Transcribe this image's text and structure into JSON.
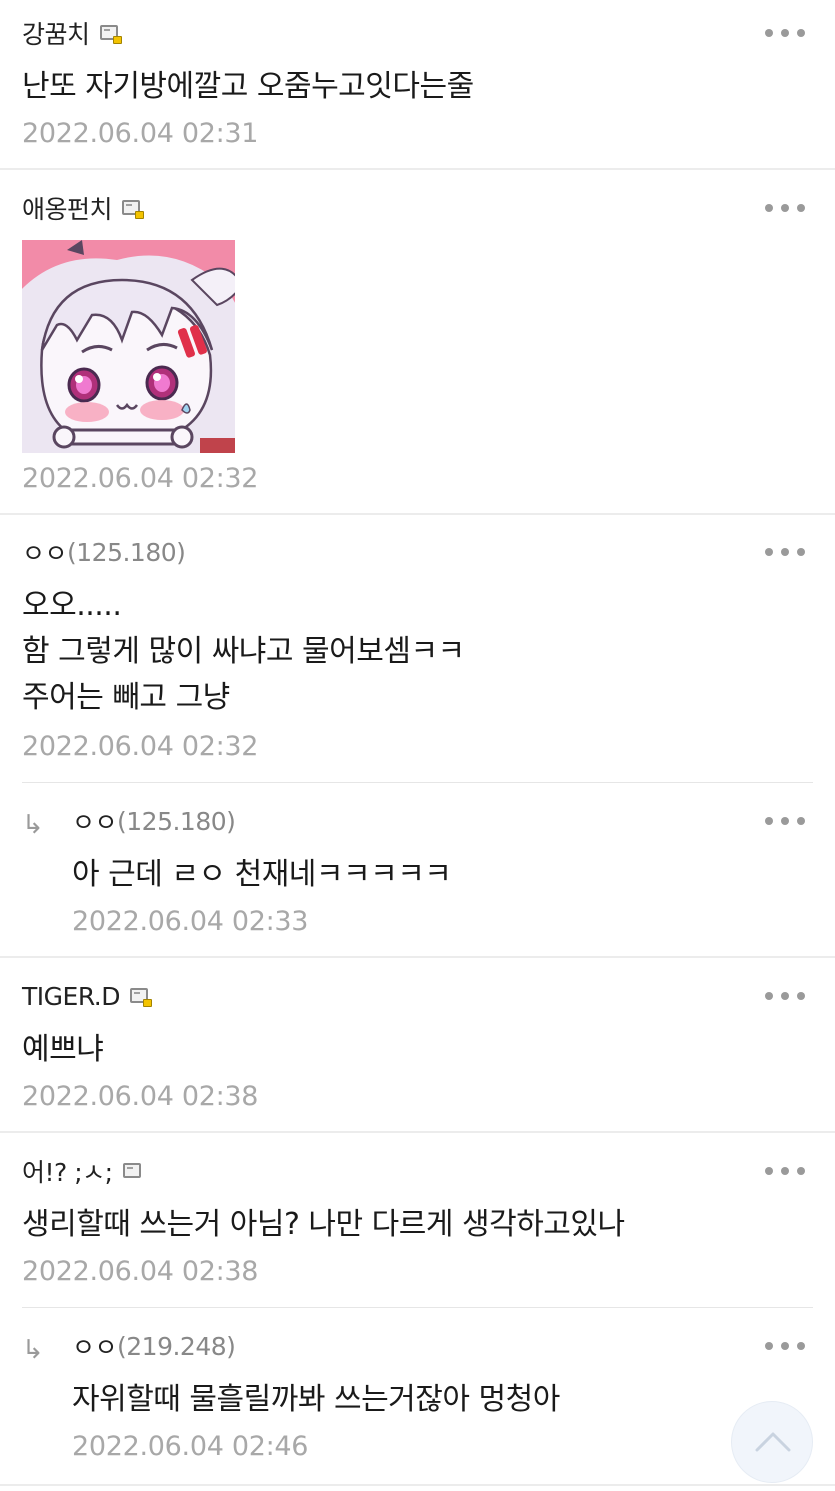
{
  "comments": [
    {
      "author": "강꿈치",
      "text": "난또 자기방에깔고 오줌누고잇다는줄",
      "date": "2022.06.04 02:31"
    },
    {
      "author": "애옹펀치",
      "sticker": "anime-girl-sticker",
      "date": "2022.06.04 02:32"
    },
    {
      "author": "ㅇㅇ",
      "ip": "(125.180)",
      "lines": [
        "오오.....",
        "함 그렇게 많이 싸냐고 물어보셈ㅋㅋ",
        "주어는 빼고 그냥"
      ],
      "date": "2022.06.04 02:32"
    },
    {
      "reply": true,
      "author": "ㅇㅇ",
      "ip": "(125.180)",
      "text": "아 근데 ㄹㅇ 천재네ㅋㅋㅋㅋㅋ",
      "date": "2022.06.04 02:33"
    },
    {
      "author": "TIGER.D",
      "text": "예쁘냐",
      "date": "2022.06.04 02:38"
    },
    {
      "author": "어!? ;ㅅ;",
      "text": "생리할때 쓰는거 아님? 나만 다르게 생각하고있나",
      "date": "2022.06.04 02:38"
    },
    {
      "reply": true,
      "author": "ㅇㅇ",
      "ip": "(219.248)",
      "text": "자위할때 물흘릴까봐 쓰는거잖아 멍청아",
      "date": "2022.06.04 02:46"
    }
  ],
  "icons": {
    "more": "more-dots-icon",
    "badge": "member-badge-icon",
    "reply": "reply-arrow-icon",
    "scroll_top": "chevron-up-icon"
  },
  "colors": {
    "text": "#1a1a1a",
    "meta": "#a8a8a8",
    "ip": "#888888",
    "divider": "#ececec",
    "sticker_bg": "#f28ba8"
  }
}
